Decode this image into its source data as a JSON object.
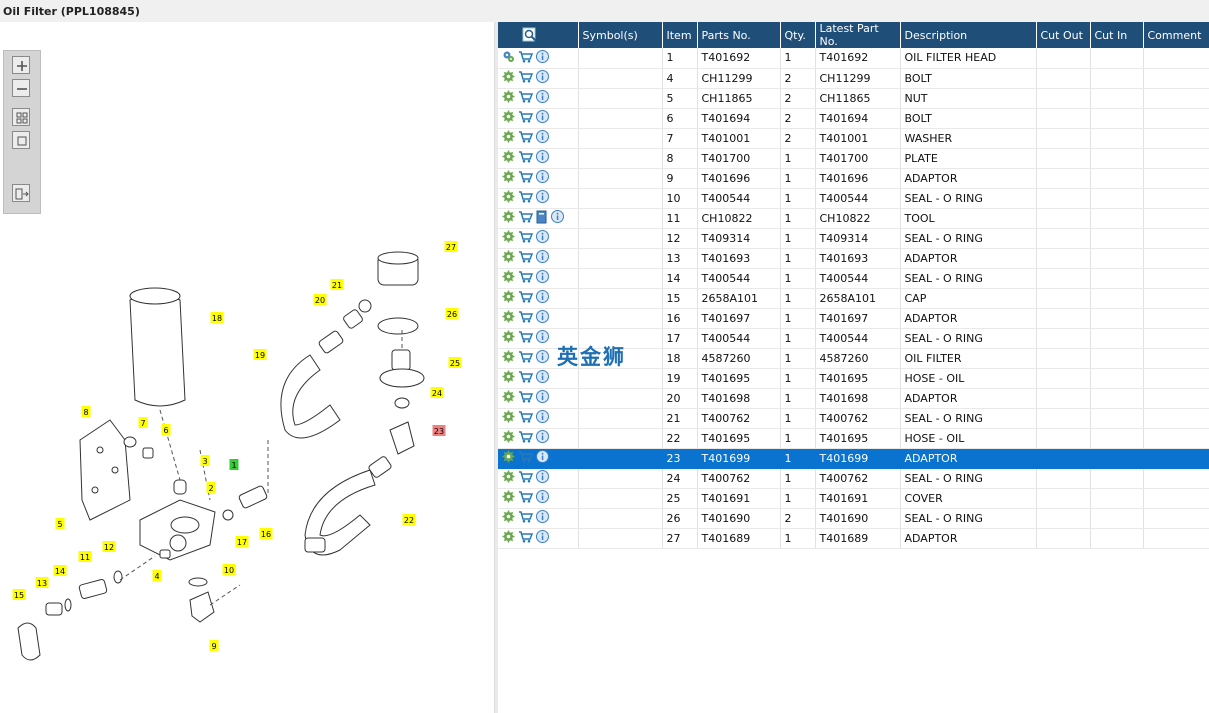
{
  "window": {
    "title": "Oil Filter (PPL108845)"
  },
  "watermark": "英金狮",
  "toolbar": {
    "buttons": [
      {
        "name": "zoom-in-button",
        "icon": "plus-icon"
      },
      {
        "name": "zoom-out-button",
        "icon": "minus-icon"
      },
      {
        "name": "fit-all-button",
        "icon": "grid-icon"
      },
      {
        "name": "fit-window-button",
        "icon": "square-icon"
      },
      {
        "name": "export-button",
        "icon": "list-arrow-icon"
      }
    ]
  },
  "diagram": {
    "callouts": [
      "1",
      "2",
      "3",
      "4",
      "5",
      "6",
      "7",
      "8",
      "9",
      "10",
      "11",
      "12",
      "13",
      "14",
      "15",
      "16",
      "17",
      "18",
      "19",
      "20",
      "21",
      "22",
      "23",
      "24",
      "25",
      "26",
      "27"
    ],
    "highlighted_callout": "23",
    "green_callout": "1"
  },
  "table": {
    "headers": {
      "symbols": "Symbol(s)",
      "item": "Item",
      "parts_no": "Parts No.",
      "qty": "Qty.",
      "latest": "Latest Part No.",
      "description": "Description",
      "cut_out": "Cut Out",
      "cut_in": "Cut In",
      "comment": "Comment"
    },
    "selected_item": "23",
    "rows": [
      {
        "item": "1",
        "parts_no": "T401692",
        "qty": "1",
        "latest": "T401692",
        "description": "OIL FILTER HEAD",
        "icons": [
          "gears-icon",
          "cart-icon",
          "info-icon"
        ]
      },
      {
        "item": "4",
        "parts_no": "CH11299",
        "qty": "2",
        "latest": "CH11299",
        "description": "BOLT",
        "icons": [
          "gear-icon",
          "cart-icon",
          "info-icon"
        ]
      },
      {
        "item": "5",
        "parts_no": "CH11865",
        "qty": "2",
        "latest": "CH11865",
        "description": "NUT",
        "icons": [
          "gear-icon",
          "cart-icon",
          "info-icon"
        ]
      },
      {
        "item": "6",
        "parts_no": "T401694",
        "qty": "2",
        "latest": "T401694",
        "description": "BOLT",
        "icons": [
          "gear-icon",
          "cart-icon",
          "info-icon"
        ]
      },
      {
        "item": "7",
        "parts_no": "T401001",
        "qty": "2",
        "latest": "T401001",
        "description": "WASHER",
        "icons": [
          "gear-icon",
          "cart-icon",
          "info-icon"
        ]
      },
      {
        "item": "8",
        "parts_no": "T401700",
        "qty": "1",
        "latest": "T401700",
        "description": "PLATE",
        "icons": [
          "gear-icon",
          "cart-icon",
          "info-icon"
        ]
      },
      {
        "item": "9",
        "parts_no": "T401696",
        "qty": "1",
        "latest": "T401696",
        "description": "ADAPTOR",
        "icons": [
          "gear-icon",
          "cart-icon",
          "info-icon"
        ]
      },
      {
        "item": "10",
        "parts_no": "T400544",
        "qty": "1",
        "latest": "T400544",
        "description": "SEAL - O RING",
        "icons": [
          "gear-icon",
          "cart-icon",
          "info-icon"
        ]
      },
      {
        "item": "11",
        "parts_no": "CH10822",
        "qty": "1",
        "latest": "CH10822",
        "description": "TOOL",
        "icons": [
          "gear-icon",
          "cart-icon",
          "book-icon",
          "info-icon"
        ]
      },
      {
        "item": "12",
        "parts_no": "T409314",
        "qty": "1",
        "latest": "T409314",
        "description": "SEAL - O RING",
        "icons": [
          "gear-icon",
          "cart-icon",
          "info-icon"
        ]
      },
      {
        "item": "13",
        "parts_no": "T401693",
        "qty": "1",
        "latest": "T401693",
        "description": "ADAPTOR",
        "icons": [
          "gear-icon",
          "cart-icon",
          "info-icon"
        ]
      },
      {
        "item": "14",
        "parts_no": "T400544",
        "qty": "1",
        "latest": "T400544",
        "description": "SEAL - O RING",
        "icons": [
          "gear-icon",
          "cart-icon",
          "info-icon"
        ]
      },
      {
        "item": "15",
        "parts_no": "2658A101",
        "qty": "1",
        "latest": "2658A101",
        "description": "CAP",
        "icons": [
          "gear-icon",
          "cart-icon",
          "info-icon"
        ]
      },
      {
        "item": "16",
        "parts_no": "T401697",
        "qty": "1",
        "latest": "T401697",
        "description": "ADAPTOR",
        "icons": [
          "gear-icon",
          "cart-icon",
          "info-icon"
        ]
      },
      {
        "item": "17",
        "parts_no": "T400544",
        "qty": "1",
        "latest": "T400544",
        "description": "SEAL - O RING",
        "icons": [
          "gear-icon",
          "cart-icon",
          "info-icon"
        ]
      },
      {
        "item": "18",
        "parts_no": "4587260",
        "qty": "1",
        "latest": "4587260",
        "description": "OIL FILTER",
        "icons": [
          "gear-icon",
          "cart-icon",
          "info-icon"
        ]
      },
      {
        "item": "19",
        "parts_no": "T401695",
        "qty": "1",
        "latest": "T401695",
        "description": "HOSE - OIL",
        "icons": [
          "gear-icon",
          "cart-icon",
          "info-icon"
        ]
      },
      {
        "item": "20",
        "parts_no": "T401698",
        "qty": "1",
        "latest": "T401698",
        "description": "ADAPTOR",
        "icons": [
          "gear-icon",
          "cart-icon",
          "info-icon"
        ]
      },
      {
        "item": "21",
        "parts_no": "T400762",
        "qty": "1",
        "latest": "T400762",
        "description": "SEAL - O RING",
        "icons": [
          "gear-icon",
          "cart-icon",
          "info-icon"
        ]
      },
      {
        "item": "22",
        "parts_no": "T401695",
        "qty": "1",
        "latest": "T401695",
        "description": "HOSE - OIL",
        "icons": [
          "gear-icon",
          "cart-icon",
          "info-icon"
        ]
      },
      {
        "item": "23",
        "parts_no": "T401699",
        "qty": "1",
        "latest": "T401699",
        "description": "ADAPTOR",
        "icons": [
          "gear-icon",
          "cart-icon",
          "info-icon"
        ]
      },
      {
        "item": "24",
        "parts_no": "T400762",
        "qty": "1",
        "latest": "T400762",
        "description": "SEAL - O RING",
        "icons": [
          "gear-icon",
          "cart-icon",
          "info-icon"
        ]
      },
      {
        "item": "25",
        "parts_no": "T401691",
        "qty": "1",
        "latest": "T401691",
        "description": "COVER",
        "icons": [
          "gear-icon",
          "cart-icon",
          "info-icon"
        ]
      },
      {
        "item": "26",
        "parts_no": "T401690",
        "qty": "2",
        "latest": "T401690",
        "description": "SEAL - O RING",
        "icons": [
          "gear-icon",
          "cart-icon",
          "info-icon"
        ]
      },
      {
        "item": "27",
        "parts_no": "T401689",
        "qty": "1",
        "latest": "T401689",
        "description": "ADAPTOR",
        "icons": [
          "gear-icon",
          "cart-icon",
          "info-icon"
        ]
      }
    ]
  },
  "colors": {
    "header_bg": "#1f4e79",
    "selection": "#0a72cf",
    "callout_yellow": "#ffff00",
    "callout_red": "#f08080",
    "callout_green": "#33cc33"
  }
}
